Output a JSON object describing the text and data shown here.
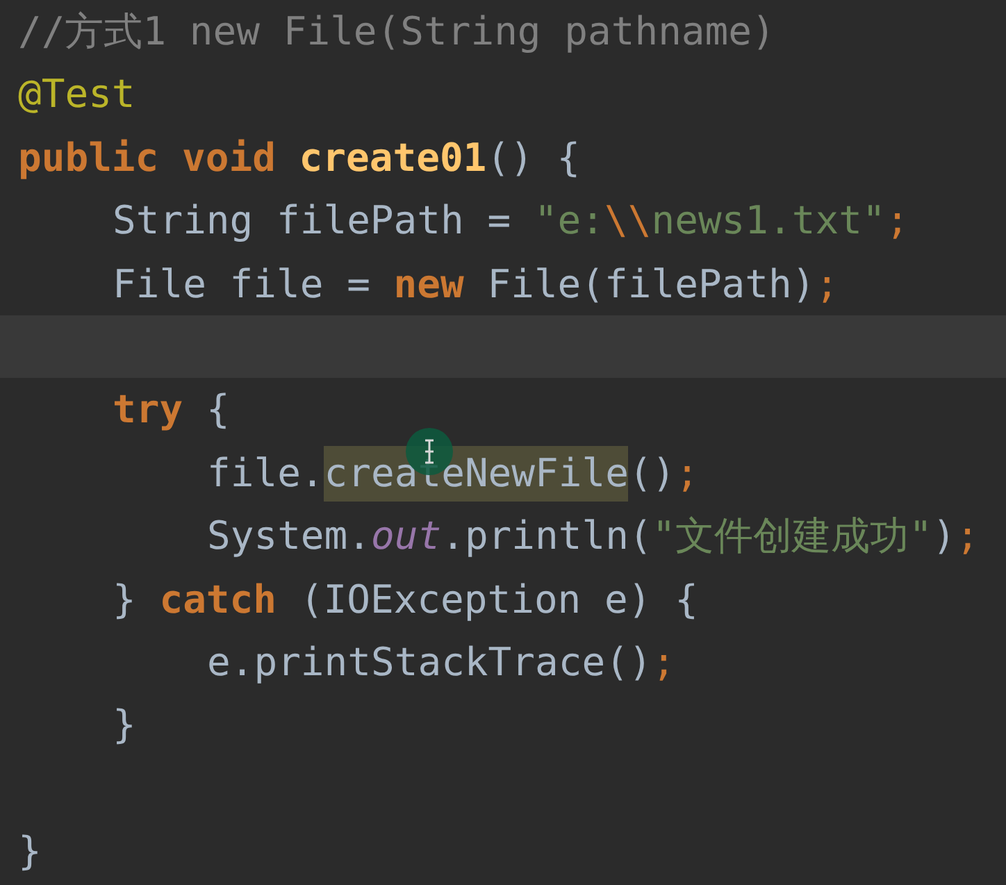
{
  "lines": [
    {
      "tokens": [
        {
          "text": "//方式1 new File(String pathname)",
          "kind": "comment"
        }
      ]
    },
    {
      "tokens": [
        {
          "text": "@Test",
          "kind": "annotation"
        }
      ]
    },
    {
      "tokens": [
        {
          "text": "public void ",
          "kind": "keyword"
        },
        {
          "text": "create01",
          "kind": "declaration"
        },
        {
          "text": "() {",
          "kind": "plain"
        }
      ],
      "children": [
        {
          "tokens": [
            {
              "text": "String filePath = ",
              "kind": "plain"
            },
            {
              "text": "\"e:",
              "kind": "string"
            },
            {
              "text": "\\\\",
              "kind": "escape"
            },
            {
              "text": "news1.txt\"",
              "kind": "string"
            },
            {
              "text": ";",
              "kind": "punct"
            }
          ]
        },
        {
          "tokens": [
            {
              "text": "File file = ",
              "kind": "plain"
            },
            {
              "text": "new ",
              "kind": "keyword"
            },
            {
              "text": "File(filePath)",
              "kind": "plain"
            },
            {
              "text": ";",
              "kind": "punct"
            }
          ]
        },
        {
          "kind": "blank",
          "current": true
        },
        {
          "tokens": [
            {
              "text": "try ",
              "kind": "keyword"
            },
            {
              "text": "{",
              "kind": "plain"
            }
          ],
          "children": [
            {
              "tokens": [
                {
                  "text": "file.",
                  "kind": "plain"
                },
                {
                  "text": "createNewFile",
                  "kind": "highlight"
                },
                {
                  "text": "()",
                  "kind": "plain"
                },
                {
                  "text": ";",
                  "kind": "punct"
                }
              ]
            },
            {
              "tokens": [
                {
                  "text": "System.",
                  "kind": "plain"
                },
                {
                  "text": "out",
                  "kind": "field"
                },
                {
                  "text": ".println(",
                  "kind": "plain"
                },
                {
                  "text": "\"文件创建成功\"",
                  "kind": "string"
                },
                {
                  "text": ")",
                  "kind": "plain"
                },
                {
                  "text": ";",
                  "kind": "punct"
                }
              ]
            }
          ]
        },
        {
          "tokens": [
            {
              "text": "} ",
              "kind": "plain"
            },
            {
              "text": "catch ",
              "kind": "keyword"
            },
            {
              "text": "(IOException e) {",
              "kind": "plain"
            }
          ],
          "children": [
            {
              "tokens": [
                {
                  "text": "e.printStackTrace()",
                  "kind": "plain"
                },
                {
                  "text": ";",
                  "kind": "punct"
                }
              ]
            }
          ]
        },
        {
          "tokens": [
            {
              "text": "}",
              "kind": "plain"
            }
          ]
        },
        {
          "kind": "blank"
        }
      ]
    },
    {
      "tokens": [
        {
          "text": "}",
          "kind": "plain"
        }
      ]
    }
  ]
}
